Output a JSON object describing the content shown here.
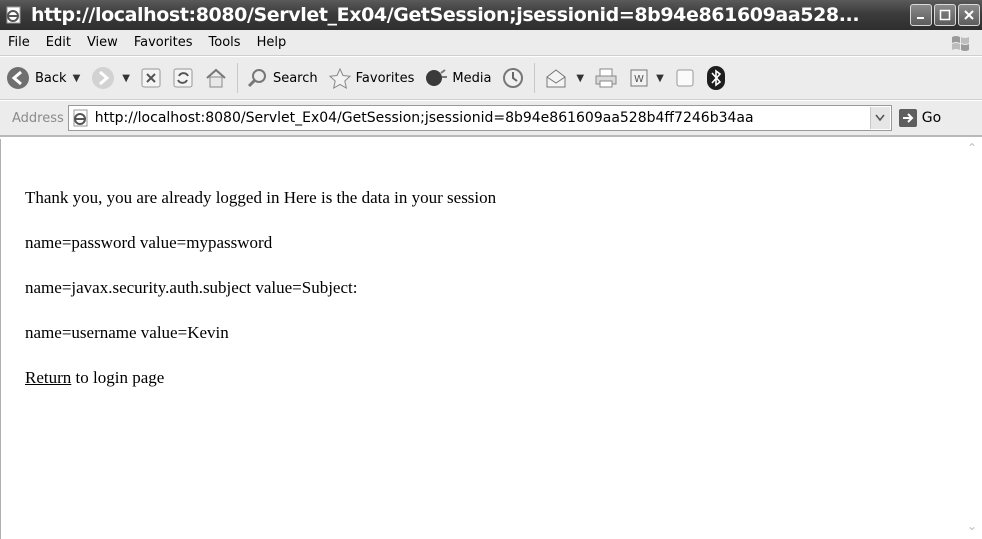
{
  "window": {
    "title": "http://localhost:8080/Servlet_Ex04/GetSession;jsessionid=8b94e861609aa528..."
  },
  "menu": [
    "File",
    "Edit",
    "View",
    "Favorites",
    "Tools",
    "Help"
  ],
  "toolbar": {
    "back_label": "Back",
    "search_label": "Search",
    "favorites_label": "Favorites",
    "media_label": "Media"
  },
  "address": {
    "label": "Address",
    "url": "http://localhost:8080/Servlet_Ex04/GetSession;jsessionid=8b94e861609aa528b4ff7246b34aa",
    "go_label": "Go"
  },
  "page": {
    "line1": "Thank you, you are already logged in Here is the data in your session",
    "line2": "name=password value=mypassword",
    "line3": "name=javax.security.auth.subject value=Subject:",
    "line4": "name=username value=Kevin",
    "return_link": "Return",
    "return_suffix": " to login page"
  }
}
